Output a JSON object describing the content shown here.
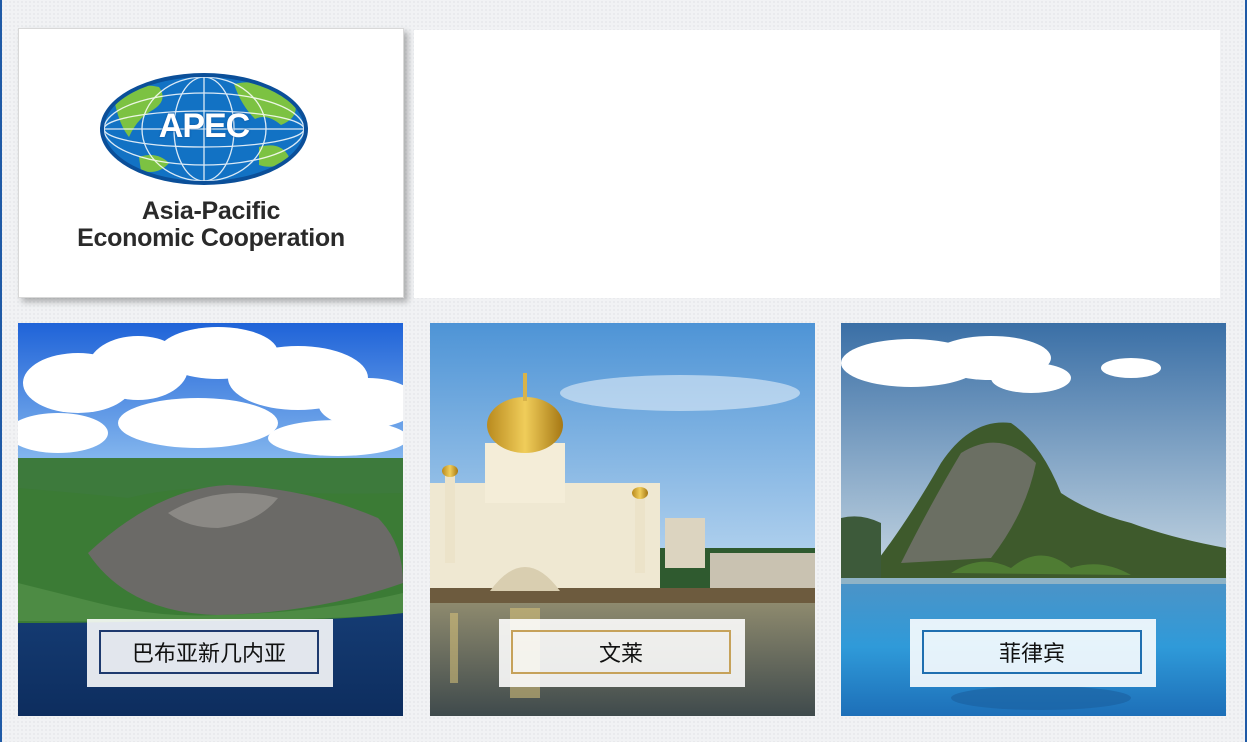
{
  "logo": {
    "acronym": "APEC",
    "line1": "Asia-Pacific",
    "line2": "Economic Cooperation"
  },
  "tiles": [
    {
      "label": "巴布亚新几内亚",
      "scene": "volcano-island"
    },
    {
      "label": "文莱",
      "scene": "golden-dome-mosque"
    },
    {
      "label": "菲律宾",
      "scene": "tropical-rock-island"
    }
  ],
  "colors": {
    "frame": "#1f5aa6",
    "apec_blue": "#0b5aa6",
    "apec_green": "#7cc242",
    "caption_border_navy": "#1e3a6e",
    "caption_border_gold": "#c6a25a",
    "caption_border_blue": "#1f6fb0"
  }
}
